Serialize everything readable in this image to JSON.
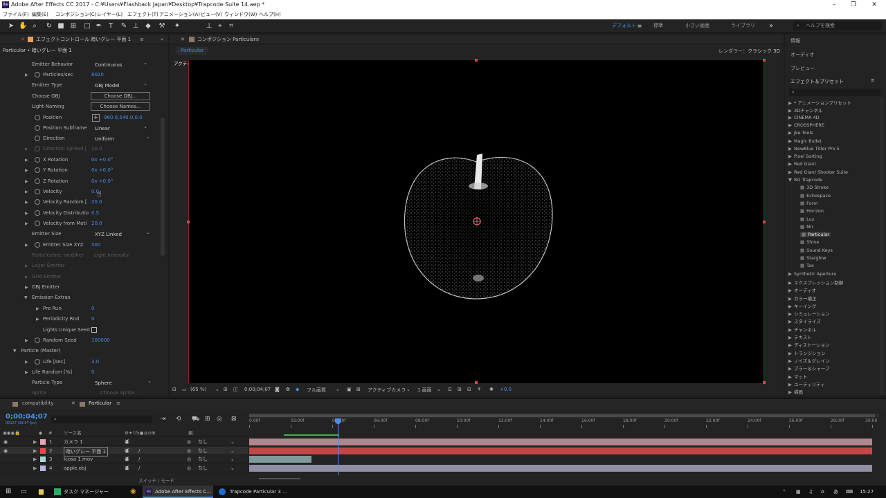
{
  "window": {
    "title": "Adobe After Effects CC 2017 - C:¥Users¥Flashback Japan¥Desktop¥Trapcode Suite 14.aep *",
    "logo": "Ae"
  },
  "menu": [
    "ファイル(F)",
    "編集(E)",
    "コンポジション(C)",
    "レイヤー(L)",
    "エフェクト(T)",
    "アニメーション(A)",
    "ビュー(V)",
    "ウィンドウ(W)",
    "ヘルプ(H)"
  ],
  "workspaces": [
    "デフォルト",
    "標準",
    "小さい画面",
    "ライブラリ"
  ],
  "help_search": "ヘルプを検索",
  "effects_panel": {
    "tab": "エフェクトコントロール 暗いグレー 平面 1",
    "breadcrumb": "Particular • 暗いグレー 平面 1",
    "rows": [
      {
        "label": "Emitter Behavior",
        "value": "Continuous"
      },
      {
        "label": "Particles/sec",
        "value": "8020"
      },
      {
        "label": "Emitter Type",
        "value": "OBJ Model"
      },
      {
        "label": "Choose OBJ",
        "value": "Choose OBJ..."
      },
      {
        "label": "Light Naming",
        "value": "Choose Names..."
      },
      {
        "label": "Position",
        "value": "960.0,540.0,0.0"
      },
      {
        "label": "Position Subframe",
        "value": "Linear"
      },
      {
        "label": "Direction",
        "value": "Uniform"
      },
      {
        "label": "Direction Spread [",
        "value": "20.0"
      },
      {
        "label": "X Rotation",
        "value": "0x +0.0°"
      },
      {
        "label": "Y Rotation",
        "value": "0x +0.0°"
      },
      {
        "label": "Z Rotation",
        "value": "0x +0.0°"
      },
      {
        "label": "Velocity",
        "value": "0.0"
      },
      {
        "label": "Velocity Random [",
        "value": "20.0"
      },
      {
        "label": "Velocity Distributio",
        "value": "0.5"
      },
      {
        "label": "Velocity from Moti",
        "value": "20.0"
      },
      {
        "label": "Emitter Size",
        "value": "XYZ Linked"
      },
      {
        "label": "Emitter Size XYZ",
        "value": "500"
      },
      {
        "label": "Particles/sec modifier",
        "value": "Light Intensity"
      },
      {
        "label": "Layer Emitter",
        "value": ""
      },
      {
        "label": "Grid Emitter",
        "value": ""
      },
      {
        "label": "OBJ Emitter",
        "value": ""
      },
      {
        "label": "Emission Extras",
        "value": ""
      },
      {
        "label": "Pre Run",
        "value": "0"
      },
      {
        "label": "Periodicity Rnd",
        "value": "0"
      },
      {
        "label": "Lights Unique Seed",
        "value": ""
      },
      {
        "label": "Random Seed",
        "value": "100000"
      },
      {
        "label": "Particle (Master)",
        "value": ""
      },
      {
        "label": "Life [sec]",
        "value": "3.0"
      },
      {
        "label": "Life Random [%]",
        "value": "0"
      },
      {
        "label": "Particle Type",
        "value": "Sphere"
      },
      {
        "label": "Sprite",
        "value": "Choose Sprite..."
      }
    ]
  },
  "composition": {
    "tab": "コンポジション Particular",
    "sub_tab": "Particular",
    "renderer_label": "レンダラー：",
    "renderer": "クラシック 3D",
    "camera_label": "アクティブカメラ",
    "footer": {
      "zoom": "(65 %)",
      "timecode": "0;00;04;07",
      "quality": "フル画質",
      "view": "アクティブカメラ",
      "layout": "1 画面",
      "exposure": "+0.0"
    }
  },
  "right_panel": {
    "sections": [
      "情報",
      "オーディオ",
      "プレビュー"
    ],
    "effects_title": "エフェクト＆プリセット",
    "tree": [
      {
        "label": "* アニメーションプリセット",
        "level": 0
      },
      {
        "label": "3Dチャンネル",
        "level": 0
      },
      {
        "label": "CINEMA 4D",
        "level": 0
      },
      {
        "label": "CROSSPHERE",
        "level": 0
      },
      {
        "label": "Jke Tools",
        "level": 0
      },
      {
        "label": "Magic Bullet",
        "level": 0
      },
      {
        "label": "NewBlue Titler Pro 5",
        "level": 0
      },
      {
        "label": "Pixel Sorting",
        "level": 0
      },
      {
        "label": "Red Giant",
        "level": 0
      },
      {
        "label": "Red Giant Shooter Suite",
        "level": 0
      },
      {
        "label": "RG Trapcode",
        "level": 0,
        "open": true
      },
      {
        "label": "3D Stroke",
        "level": 1
      },
      {
        "label": "Echospace",
        "level": 1
      },
      {
        "label": "Form",
        "level": 1
      },
      {
        "label": "Horizon",
        "level": 1
      },
      {
        "label": "Lux",
        "level": 1
      },
      {
        "label": "Mir",
        "level": 1
      },
      {
        "label": "Particular",
        "level": 1,
        "selected": true
      },
      {
        "label": "Shine",
        "level": 1
      },
      {
        "label": "Sound Keys",
        "level": 1
      },
      {
        "label": "Starglow",
        "level": 1
      },
      {
        "label": "Tao",
        "level": 1
      },
      {
        "label": "Synthetic Aperture",
        "level": 0
      },
      {
        "label": "エクスプレッション制御",
        "level": 0
      },
      {
        "label": "オーディオ",
        "level": 0
      },
      {
        "label": "カラー補正",
        "level": 0
      },
      {
        "label": "キーイング",
        "level": 0
      },
      {
        "label": "シミュレーション",
        "level": 0
      },
      {
        "label": "スタイライズ",
        "level": 0
      },
      {
        "label": "チャンネル",
        "level": 0
      },
      {
        "label": "テキスト",
        "level": 0
      },
      {
        "label": "ディストーション",
        "level": 0
      },
      {
        "label": "トランジション",
        "level": 0
      },
      {
        "label": "ノイズ＆グレイン",
        "level": 0
      },
      {
        "label": "ブラー＆シャープ",
        "level": 0
      },
      {
        "label": "マット",
        "level": 0
      },
      {
        "label": "ユーティリティ",
        "level": 0
      },
      {
        "label": "描画",
        "level": 0
      }
    ]
  },
  "timeline": {
    "tabs": [
      "compatibility",
      "Particular"
    ],
    "timecode": "0;00;04;07",
    "fps": "00127 (29.97 fps)",
    "col_name": "ソース名",
    "col_parent": "親",
    "switch_mode": "スイッチ / モード",
    "ruler": [
      "0:00f",
      "02:00f",
      "04:00f",
      "06:00f",
      "08:00f",
      "10:00f",
      "12:00f",
      "14:00f",
      "16:00f",
      "18:00f",
      "20:00f",
      "22:00f",
      "24:00f",
      "26:00f",
      "28:00f",
      "30:00"
    ],
    "layers": [
      {
        "num": "1",
        "name": "カメラ 1",
        "parent": "なし",
        "color": "#e6a5b4"
      },
      {
        "num": "2",
        "name": "暗いグレー 平面 1",
        "parent": "なし",
        "color": "#e64b4b"
      },
      {
        "num": "3",
        "name": "Icosa 1.mov",
        "parent": "なし",
        "color": "#a9d4d4"
      },
      {
        "num": "4",
        "name": "apple.obj",
        "parent": "なし",
        "color": "#b6b6e0"
      }
    ]
  },
  "taskbar": {
    "items": [
      "タスク マネージャー",
      "Adobe After Effects C...",
      "Trapcode Particular 3 ..."
    ],
    "time": "15:27"
  }
}
